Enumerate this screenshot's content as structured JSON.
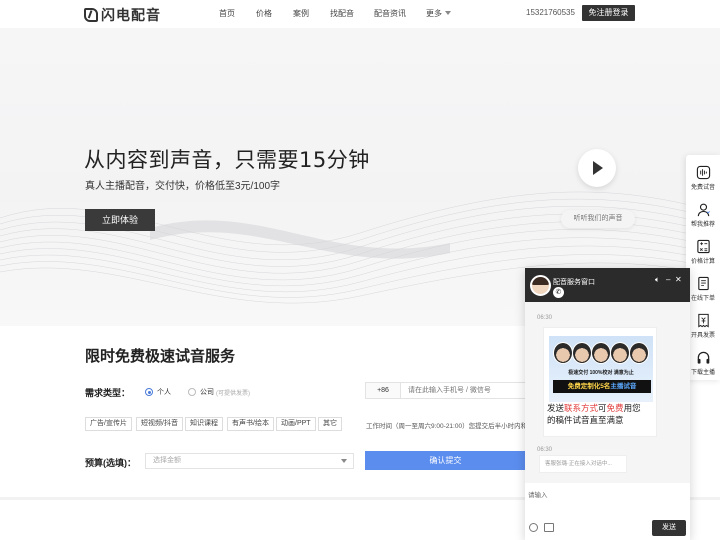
{
  "nav": {
    "logo": "闪电配音",
    "items": [
      "首页",
      "价格",
      "案例",
      "找配音",
      "配音资讯",
      "更多"
    ],
    "phone": "15321760535",
    "login": "免注册登录"
  },
  "hero": {
    "title": "从内容到声音，只需要15分钟",
    "subtitle": "真人主播配音，交付快，价格低至3元/100字",
    "cta": "立即体验",
    "listen": "听听我们的声音"
  },
  "form": {
    "title": "限时免费极速试音服务",
    "type_label": "需求类型：",
    "radio_personal": "个人",
    "radio_company": "公司",
    "radio_company_hint": "(可提供发票)",
    "tags": [
      "广告/宣传片",
      "短视频/抖音",
      "知识课程",
      "有声书/绘本",
      "动画/PPT",
      "其它"
    ],
    "phone_prefix": "+86",
    "phone_placeholder": "请在此输入手机号 / 微信号",
    "worktime": "工作时间（周一至周六9:00-21:00）您提交后半小时内和",
    "budget_label": "预算(选填)：",
    "budget_placeholder": "选择金额",
    "submit": "确认提交"
  },
  "sidebar": {
    "items": [
      "免费试音",
      "帮我推荐",
      "价格计算",
      "在线下单",
      "开具发票",
      "下载主播"
    ]
  },
  "chat": {
    "title": "配音服务窗口",
    "time1": "06:30",
    "promo_bullets": "极速交付   100%校对   满意为止",
    "promo_bar_a": "免费定制化5名",
    "promo_bar_b": "主播试音",
    "card_line1_a": "发送",
    "card_line1_b": "联系方式",
    "card_line1_c": "可",
    "card_line1_d": "免费",
    "card_line1_e": "用您",
    "card_line2": "的稿件试音直至满意",
    "time2": "06:30",
    "typing": "客服张璐·正在接入对话中...",
    "input_placeholder": "请输入",
    "send": "发送"
  }
}
